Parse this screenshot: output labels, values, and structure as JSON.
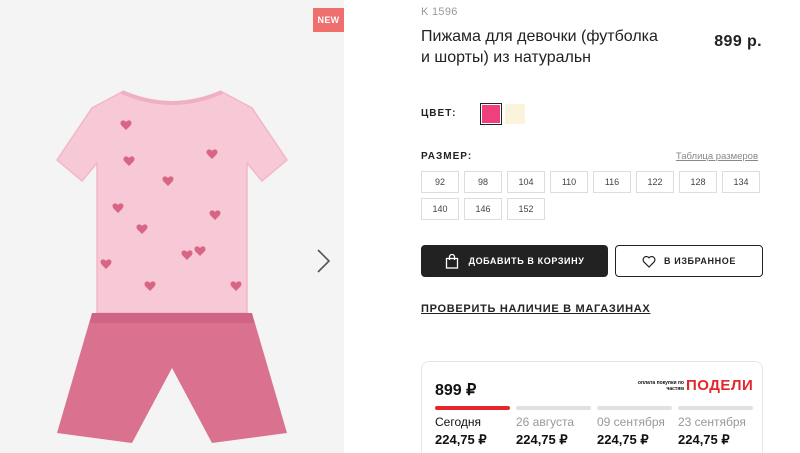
{
  "gallery": {
    "badge": "NEW",
    "product_image": "pink-pajama-tshirt-shorts",
    "next_icon": "chevron-right-icon"
  },
  "product": {
    "sku": "K 1596",
    "title": "Пижама для девочки (футболка и шорты) из натуральн",
    "price": "899 р."
  },
  "color": {
    "label": "ЦВЕТ:",
    "swatches": [
      {
        "name": "pink",
        "hex": "#ef3f7c",
        "selected": true
      },
      {
        "name": "cream",
        "hex": "#fbf3dc",
        "selected": false
      }
    ]
  },
  "size": {
    "label": "РАЗМЕР:",
    "guide_link": "Таблица размеров",
    "options": [
      "92",
      "98",
      "104",
      "110",
      "116",
      "122",
      "128",
      "134",
      "140",
      "146",
      "152"
    ]
  },
  "actions": {
    "add_to_cart": "ДОБАВИТЬ В КОРЗИНУ",
    "add_to_cart_icon": "shopping-bag-icon",
    "favorite": "В ИЗБРАННОЕ",
    "favorite_icon": "heart-icon",
    "check_stock": "ПРОВЕРИТЬ НАЛИЧИЕ В МАГАЗИНАХ"
  },
  "podeli": {
    "total": "899 ₽",
    "small_text": "оплата покупки по частям",
    "logo": "ПОДЕЛИ",
    "brand_color": "#e4262d",
    "payments": [
      {
        "date": "Сегодня",
        "amount": "224,75 ₽",
        "active": true
      },
      {
        "date": "26 августа",
        "amount": "224,75 ₽",
        "active": false
      },
      {
        "date": "09 сентября",
        "amount": "224,75 ₽",
        "active": false
      },
      {
        "date": "23 сентября",
        "amount": "224,75 ₽",
        "active": false
      }
    ]
  }
}
